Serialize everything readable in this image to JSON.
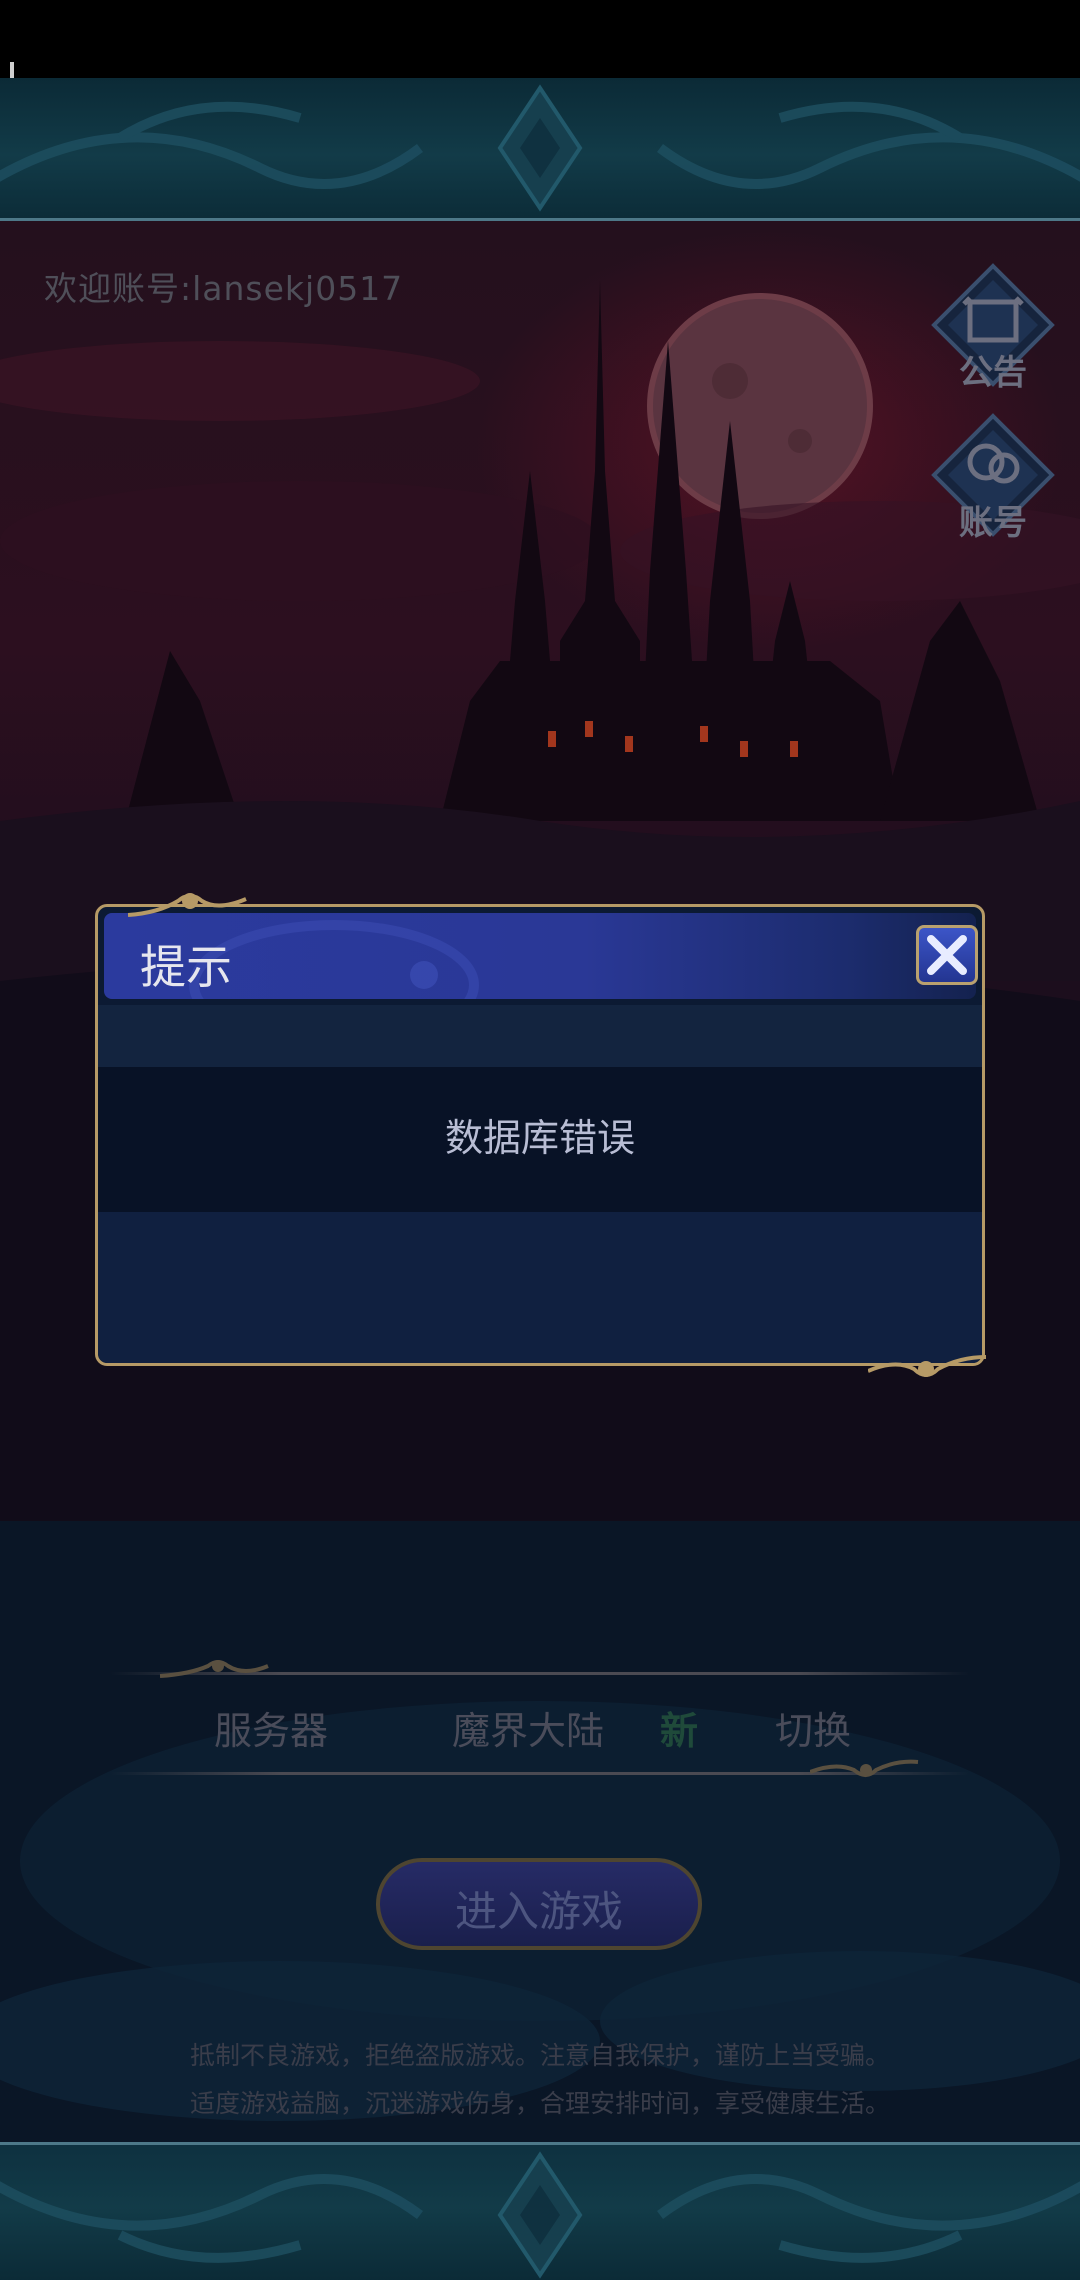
{
  "header": {
    "welcome_text": "欢迎账号:lansekj0517"
  },
  "side_buttons": {
    "notice_label": "公告",
    "account_label": "账号"
  },
  "dialog": {
    "title": "提示",
    "message": "数据库错误",
    "close_icon": "close-x-icon"
  },
  "server": {
    "label": "服务器",
    "name": "魔界大陆",
    "badge": "新",
    "switch_label": "切换"
  },
  "enter_button": {
    "label": "进入游戏"
  },
  "advice": {
    "line1": "抵制不良游戏，拒绝盗版游戏。注意自我保护，谨防上当受骗。",
    "line2": "适度游戏益脑，沉迷游戏伤身，合理安排时间，享受健康生活。"
  },
  "colors": {
    "dialog_border": "#b69a66",
    "dialog_header": "#2b3a9e",
    "new_badge": "#1f4a3a"
  }
}
